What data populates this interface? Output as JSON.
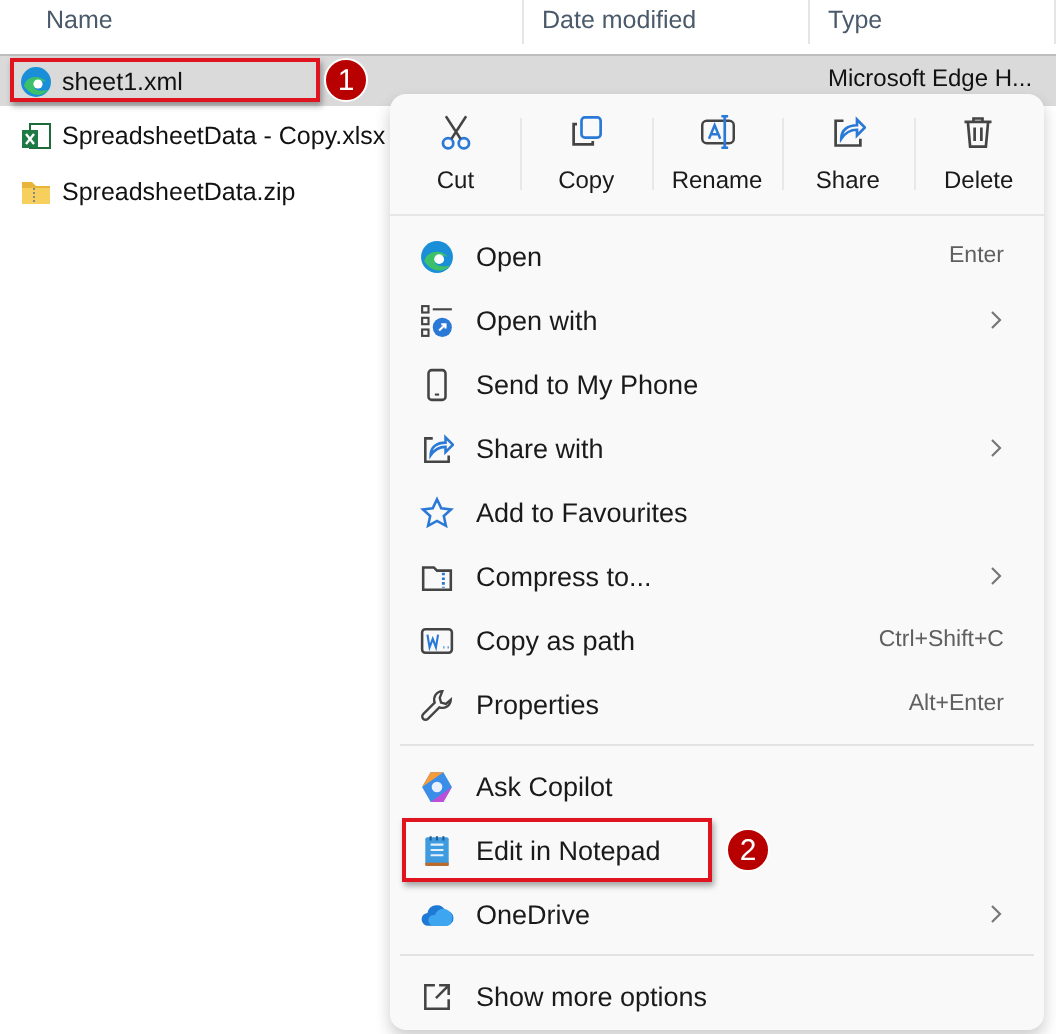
{
  "columns": [
    {
      "label": "Name"
    },
    {
      "label": "Date modified"
    },
    {
      "label": "Type"
    }
  ],
  "files": [
    {
      "name": "sheet1.xml",
      "type": "Microsoft Edge H...",
      "selected": true,
      "callout": "1"
    },
    {
      "name": "SpreadsheetData - Copy.xlsx",
      "selected": false
    },
    {
      "name": "SpreadsheetData.zip",
      "selected": false
    }
  ],
  "context_menu": {
    "actions": [
      {
        "label": "Cut"
      },
      {
        "label": "Copy"
      },
      {
        "label": "Rename"
      },
      {
        "label": "Share"
      },
      {
        "label": "Delete"
      }
    ],
    "sections": [
      [
        {
          "label": "Open",
          "shortcut": "Enter",
          "submenu": false
        },
        {
          "label": "Open with",
          "submenu": true
        },
        {
          "label": "Send to My Phone",
          "submenu": false
        },
        {
          "label": "Share with",
          "submenu": true
        },
        {
          "label": "Add to Favourites",
          "submenu": false
        },
        {
          "label": "Compress to...",
          "submenu": true
        },
        {
          "label": "Copy as path",
          "shortcut": "Ctrl+Shift+C",
          "submenu": false
        },
        {
          "label": "Properties",
          "shortcut": "Alt+Enter",
          "submenu": false
        }
      ],
      [
        {
          "label": "Ask Copilot",
          "submenu": false
        },
        {
          "label": "Edit in Notepad",
          "submenu": false,
          "callout": "2"
        },
        {
          "label": "OneDrive",
          "submenu": true
        }
      ],
      [
        {
          "label": "Show more options",
          "submenu": false
        }
      ]
    ]
  }
}
